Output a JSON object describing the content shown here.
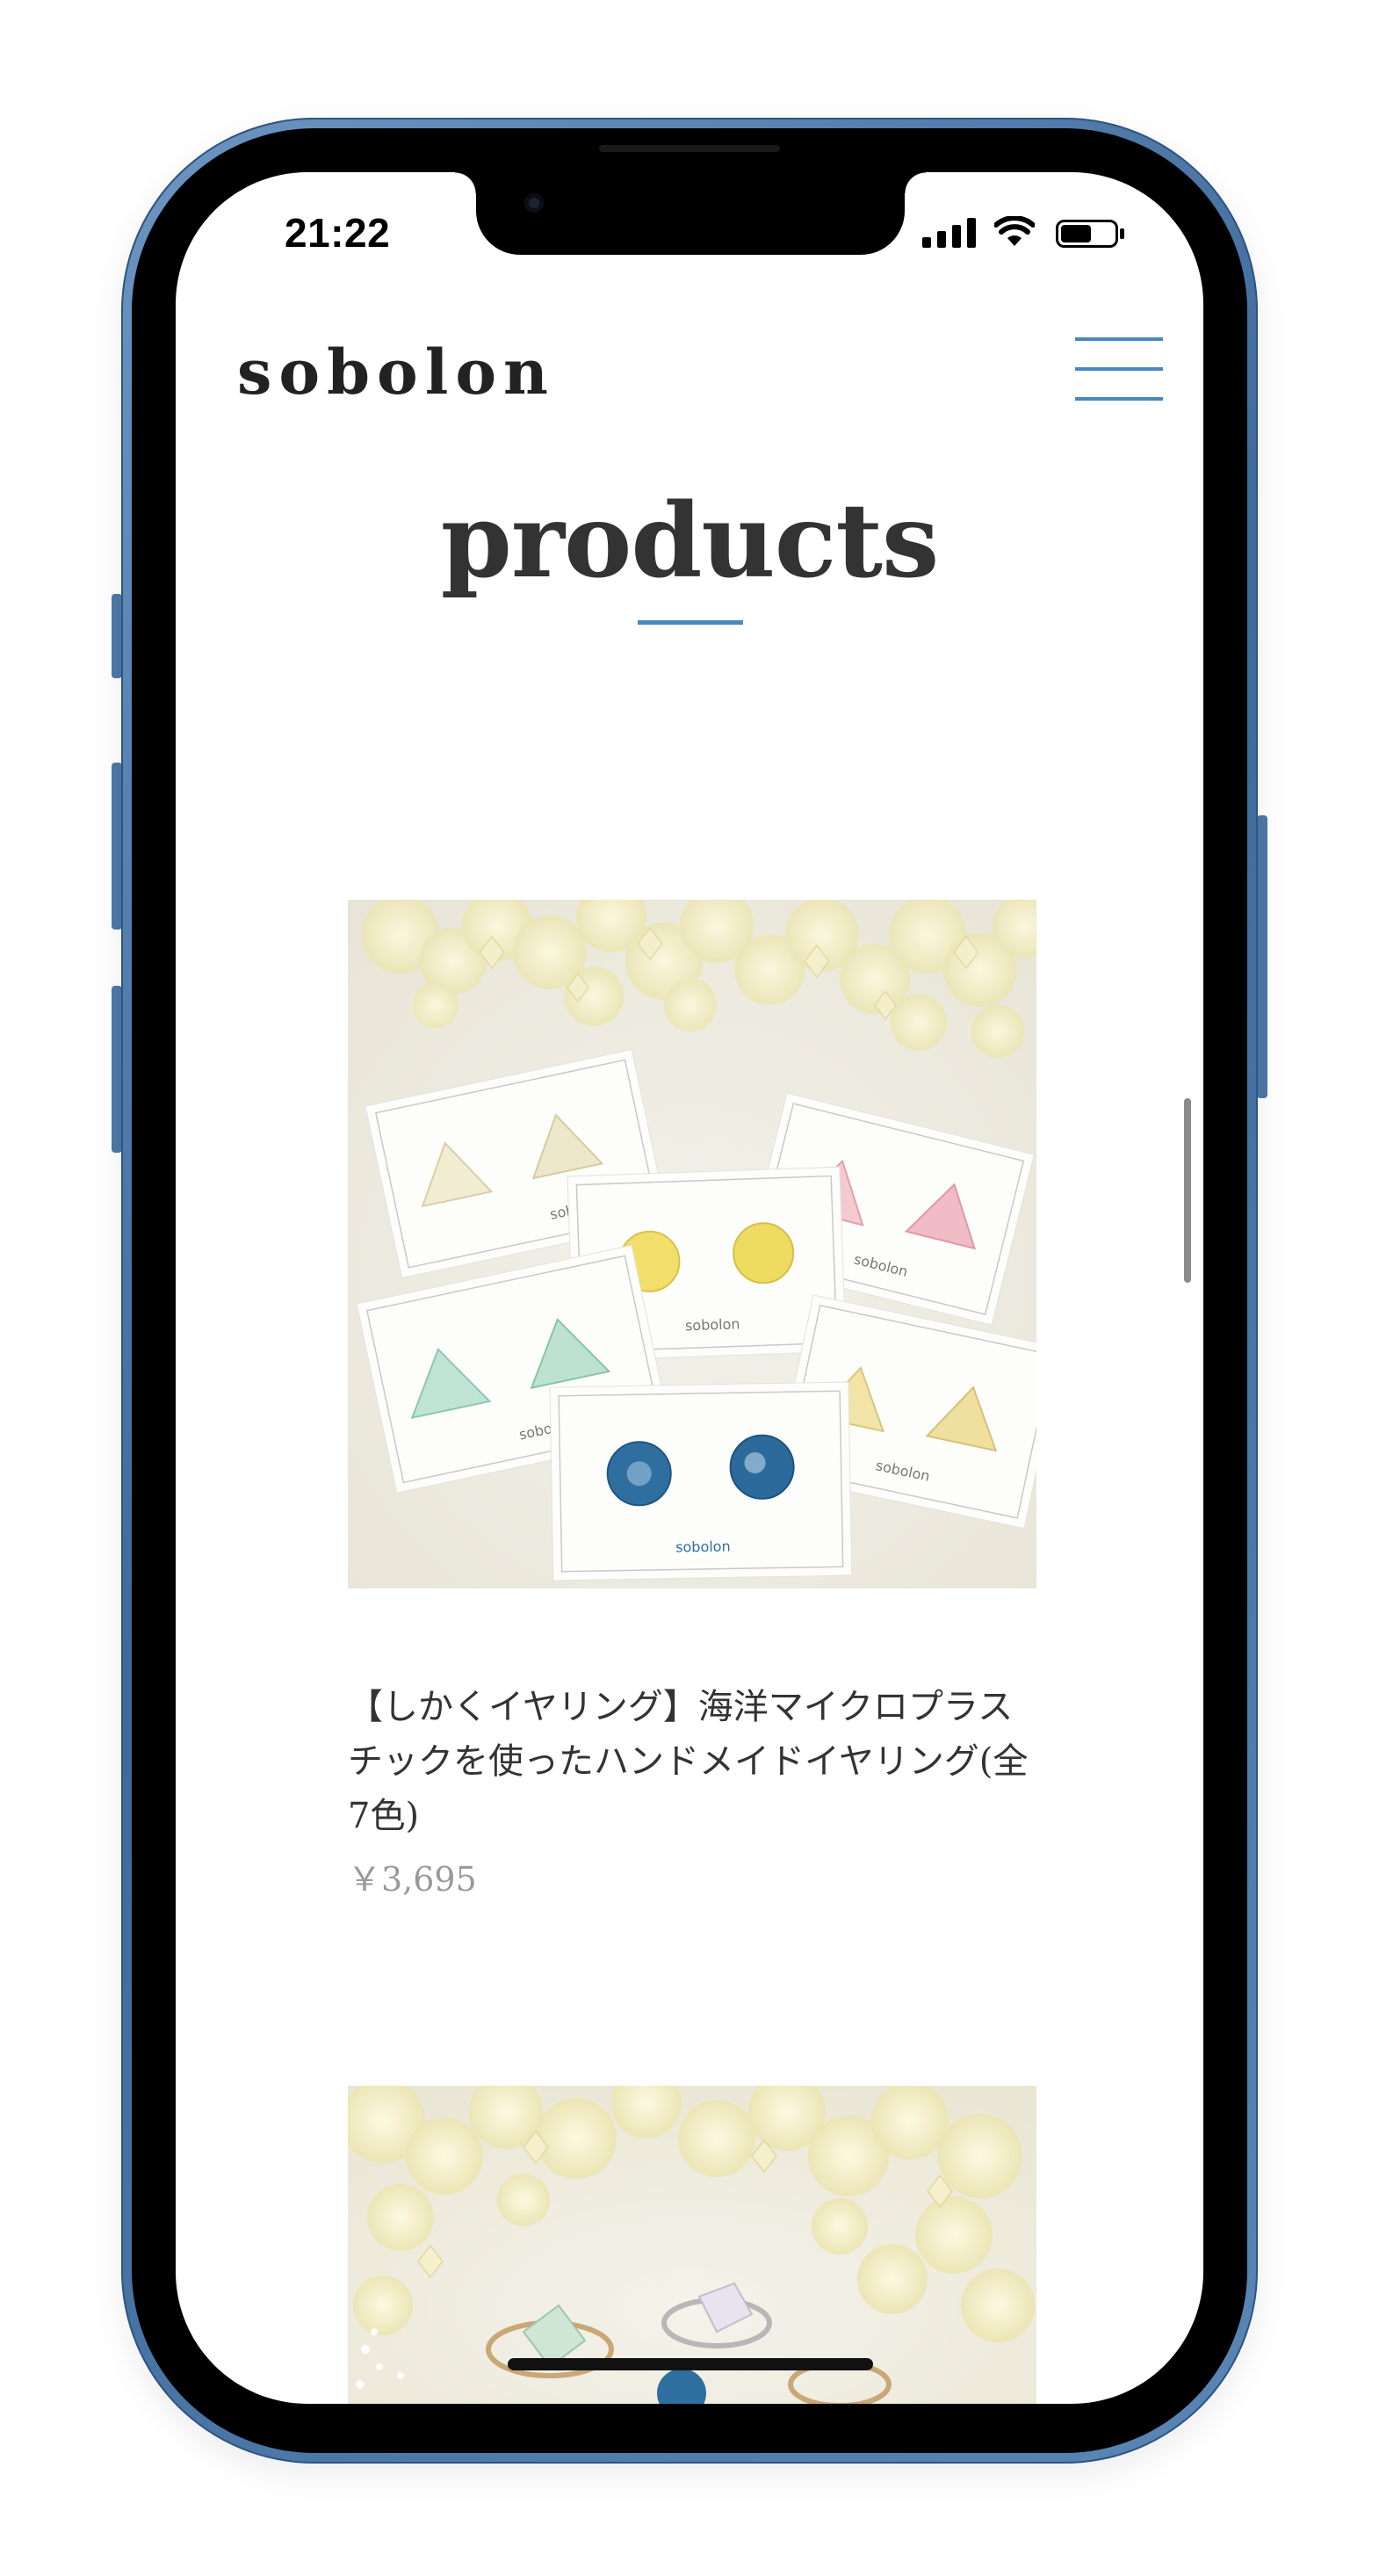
{
  "status_bar": {
    "time": "21:22"
  },
  "header": {
    "brand": "sobolon",
    "menu_icon": "hamburger-menu-icon"
  },
  "main": {
    "title": "products",
    "products": [
      {
        "name": "【しかくイヤリング】海洋マイクロプラスチックを使ったハンドメイドイヤリング(全7色)",
        "price": "￥3,695",
        "image_alt": "sobolon earrings on cards with hydrangea flowers",
        "card_label": "sobolon"
      },
      {
        "name": "",
        "price": "",
        "image_alt": "sobolon rings with hydrangea flowers"
      }
    ]
  },
  "colors": {
    "accent": "#4a86bf",
    "text": "#333333",
    "price": "#9a9a9a",
    "phone_frame": "#4d78a6"
  }
}
